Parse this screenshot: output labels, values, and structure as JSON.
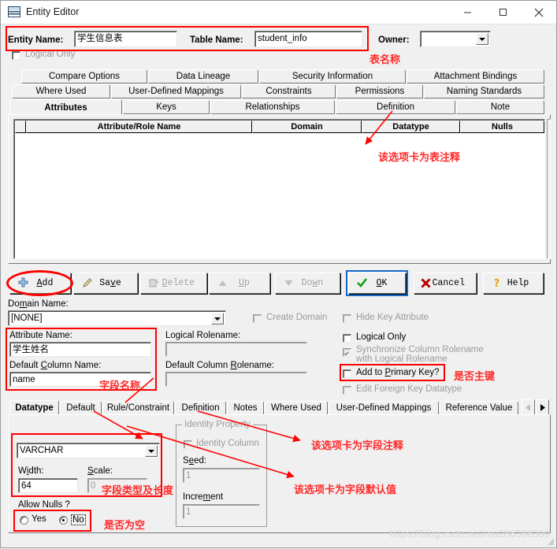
{
  "window": {
    "title": "Entity Editor",
    "icon": "entity-table-icon",
    "controls": {
      "minimize": "—",
      "maximize": "☐",
      "close": "✕"
    }
  },
  "header": {
    "entity_name_label": "Entity Name:",
    "entity_name_value": "学生信息表",
    "table_name_label": "Table Name:",
    "table_name_value": "student_info",
    "owner_label": "Owner:",
    "owner_value": "",
    "logical_only_label": "Logical Only",
    "logical_only_checked": false
  },
  "entity_tabs": {
    "row1": [
      "Compare Options",
      "Data Lineage",
      "Security Information",
      "Attachment Bindings"
    ],
    "row2": [
      "Where Used",
      "User-Defined Mappings",
      "Constraints",
      "Permissions",
      "Naming Standards"
    ],
    "row3": [
      "Attributes",
      "Keys",
      "Relationships",
      "Definition",
      "Note"
    ],
    "active": "Attributes"
  },
  "grid": {
    "columns": [
      "Attribute/Role Name",
      "Domain",
      "Datatype",
      "Nulls"
    ],
    "rows": []
  },
  "toolbar": {
    "add": {
      "label": "Add",
      "icon": "plus-icon",
      "enabled": true
    },
    "save": {
      "label": "Save",
      "icon": "pencil-icon",
      "enabled": true
    },
    "delete": {
      "label": "Delete",
      "icon": "delete-icon",
      "enabled": false
    },
    "up": {
      "label": "Up",
      "icon": "triangle-up-icon",
      "enabled": false
    },
    "down": {
      "label": "Down",
      "icon": "triangle-down-icon",
      "enabled": false
    },
    "ok": {
      "label": "OK",
      "icon": "check-icon",
      "enabled": true
    },
    "cancel": {
      "label": "Cancel",
      "icon": "x-icon",
      "enabled": true
    },
    "help": {
      "label": "Help",
      "icon": "question-icon",
      "enabled": true
    }
  },
  "attribute_form": {
    "domain_name_label": "Domain Name:",
    "domain_name_value": "[NONE]",
    "attribute_name_label": "Attribute Name:",
    "attribute_name_value": "学生姓名",
    "default_column_name_label": "Default Column Name:",
    "default_column_name_value": "name",
    "logical_rolename_label": "Logical Rolename:",
    "logical_rolename_value": "",
    "default_column_rolename_label": "Default Column Rolename:",
    "default_column_rolename_value": "",
    "checks": [
      {
        "label": "Create Domain",
        "checked": false,
        "enabled": false
      },
      {
        "label": "Hide Key Attribute",
        "checked": false,
        "enabled": false
      },
      {
        "label": "Logical Only",
        "checked": false,
        "enabled": true
      },
      {
        "label": "Synchronize Column Rolename",
        "label2": "with Logical Rolename",
        "checked": true,
        "enabled": false
      },
      {
        "label": "Add to Primary Key?",
        "checked": false,
        "enabled": true
      },
      {
        "label": "Edit Foreign Key Datatype",
        "checked": false,
        "enabled": false
      }
    ]
  },
  "datatype_tabs": {
    "items": [
      "Datatype",
      "Default",
      "Rule/Constraint",
      "Definition",
      "Notes",
      "Where Used",
      "User-Defined Mappings",
      "Reference Value"
    ],
    "active": "Datatype",
    "scroll_left": "◀",
    "scroll_right": "▶"
  },
  "datatype_panel": {
    "datatype_value": "VARCHAR",
    "width_label": "Width:",
    "width_value": "64",
    "scale_label": "Scale:",
    "scale_value": "0",
    "allow_nulls_label": "Allow Nulls ?",
    "yes_label": "Yes",
    "no_label": "No",
    "allow_nulls_selected": "No",
    "identity_group_title": "Identity Property",
    "identity_column_label": "Identity Column",
    "identity_column_checked": false,
    "seed_label": "Seed:",
    "seed_value": "1",
    "increment_label": "Increment",
    "increment_value": "1"
  },
  "annotations": {
    "table_name": "表名称",
    "table_comment_tab": "该选项卡为表注释",
    "field_name": "字段名称",
    "is_primary_key": "是否主键",
    "field_comment_tab": "该选项卡为字段注释",
    "field_default_tab": "该选项卡为字段默认值",
    "field_type_length": "字段类型及长度",
    "is_nullable": "是否为空"
  },
  "watermark": "https://blog.csdn.net/ma286388309"
}
